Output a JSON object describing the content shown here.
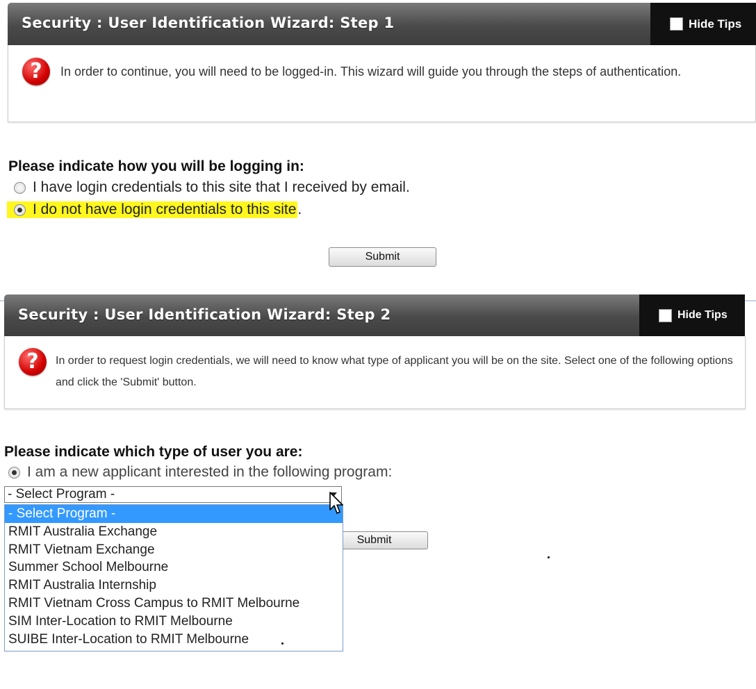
{
  "step1": {
    "title": "Security : User Identification Wizard: Step 1",
    "hide_tips_label": "Hide Tips",
    "tip_text": "In order to continue, you will need to be logged-in. This wizard will guide you through the steps of authentication.",
    "question": "Please indicate how you will be logging in:",
    "options": [
      "I have login credentials to this site that I received by email.",
      "I do not have login credentials to this site"
    ],
    "option2_trailing": ".",
    "selected_option": 1,
    "submit_label": "Submit",
    "highlight_color": "#fff71f"
  },
  "step2": {
    "title": "Security : User Identification Wizard: Step 2",
    "hide_tips_label": "Hide Tips",
    "tip_text": "In order to request login credentials, we will need to know what type of applicant you will be on the site. Select one of the following options and click the 'Submit' button.",
    "question": "Please indicate which type of user you are:",
    "option": "I am a new applicant interested in the following program:",
    "select_value": "- Select Program -",
    "dropdown_options": [
      "- Select Program -",
      "RMIT Australia Exchange",
      "RMIT Vietnam Exchange",
      "Summer School Melbourne",
      "RMIT Australia Internship",
      "RMIT Vietnam Cross Campus to RMIT Melbourne",
      "SIM Inter-Location to RMIT Melbourne",
      "SUIBE Inter-Location to RMIT Melbourne"
    ],
    "highlighted_option_index": 0,
    "submit_label": "Submit",
    "selection_color": "#3399ff"
  },
  "icons": {
    "help": "question-mark-icon",
    "checkbox": "checkbox-icon",
    "cursor": "mouse-pointer-icon"
  }
}
